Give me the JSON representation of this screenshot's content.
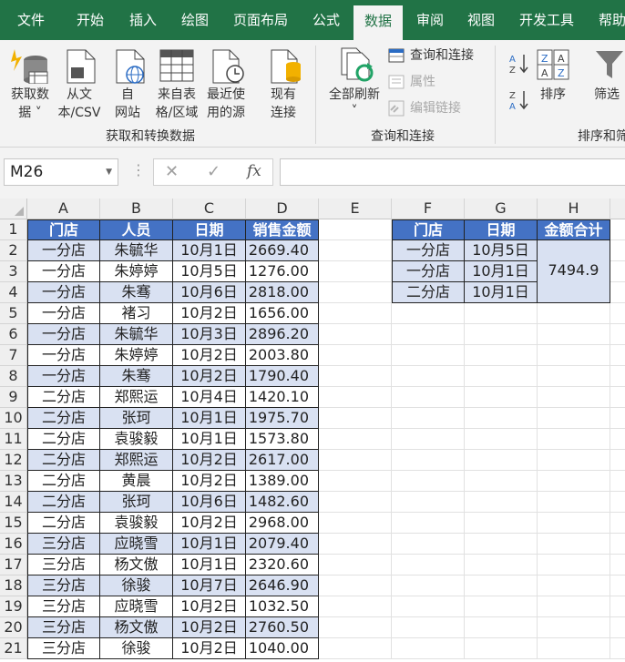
{
  "menu": {
    "tabs": [
      {
        "label": "文件"
      },
      {
        "label": "开始"
      },
      {
        "label": "插入"
      },
      {
        "label": "绘图"
      },
      {
        "label": "页面布局"
      },
      {
        "label": "公式"
      },
      {
        "label": "数据",
        "active": true
      },
      {
        "label": "审阅"
      },
      {
        "label": "视图"
      },
      {
        "label": "开发工具"
      },
      {
        "label": "帮助"
      }
    ]
  },
  "ribbon": {
    "get_data": {
      "line1": "获取数",
      "line2": "据 ˅"
    },
    "from_csv": {
      "line1": "从文",
      "line2": "本/CSV"
    },
    "from_web": {
      "line1": "自",
      "line2": "网站"
    },
    "from_table": {
      "line1": "来自表",
      "line2": "格/区域"
    },
    "recent_sources": {
      "line1": "最近使",
      "line2": "用的源"
    },
    "existing_connections": {
      "line1": "现有",
      "line2": "连接"
    },
    "group_get_transform": "获取和转换数据",
    "refresh_all": {
      "line1": "全部刷新",
      "line2": "˅"
    },
    "queries_connections": "查询和连接",
    "properties": "属性",
    "edit_links": "编辑链接",
    "group_queries": "查询和连接",
    "sort": "排序",
    "filter": "筛选",
    "group_sort_filter": "排序和筛"
  },
  "formula_bar": {
    "name_box": "M26",
    "cancel_glyph": "✕",
    "enter_glyph": "✓",
    "fx": "fx",
    "formula": ""
  },
  "sheet": {
    "columns": [
      "A",
      "B",
      "C",
      "D",
      "E",
      "F",
      "G",
      "H"
    ],
    "rows": [
      "1",
      "2",
      "3",
      "4",
      "5",
      "6",
      "7",
      "8",
      "9",
      "10",
      "11",
      "12",
      "13",
      "14",
      "15",
      "16",
      "17",
      "18",
      "19",
      "20",
      "21"
    ],
    "main_table": {
      "headers": [
        "门店",
        "人员",
        "日期",
        "销售金额"
      ],
      "rows": [
        [
          "一分店",
          "朱毓华",
          "10月1日",
          "2669.40"
        ],
        [
          "一分店",
          "朱婷婷",
          "10月5日",
          "1276.00"
        ],
        [
          "一分店",
          "朱骞",
          "10月6日",
          "2818.00"
        ],
        [
          "一分店",
          "褚习",
          "10月2日",
          "1656.00"
        ],
        [
          "一分店",
          "朱毓华",
          "10月3日",
          "2896.20"
        ],
        [
          "一分店",
          "朱婷婷",
          "10月2日",
          "2003.80"
        ],
        [
          "一分店",
          "朱骞",
          "10月2日",
          "1790.40"
        ],
        [
          "二分店",
          "郑熙运",
          "10月4日",
          "1420.10"
        ],
        [
          "二分店",
          "张珂",
          "10月1日",
          "1975.70"
        ],
        [
          "二分店",
          "袁骏毅",
          "10月1日",
          "1573.80"
        ],
        [
          "二分店",
          "郑熙运",
          "10月2日",
          "2617.00"
        ],
        [
          "二分店",
          "黄晨",
          "10月2日",
          "1389.00"
        ],
        [
          "二分店",
          "张珂",
          "10月6日",
          "1482.60"
        ],
        [
          "二分店",
          "袁骏毅",
          "10月2日",
          "2968.00"
        ],
        [
          "三分店",
          "应晓雪",
          "10月1日",
          "2079.40"
        ],
        [
          "三分店",
          "杨文傲",
          "10月1日",
          "2320.60"
        ],
        [
          "三分店",
          "徐骏",
          "10月7日",
          "2646.90"
        ],
        [
          "三分店",
          "应晓雪",
          "10月2日",
          "1032.50"
        ],
        [
          "三分店",
          "杨文傲",
          "10月2日",
          "2760.50"
        ],
        [
          "三分店",
          "徐骏",
          "10月2日",
          "1040.00"
        ]
      ]
    },
    "criteria_table": {
      "headers": [
        "门店",
        "日期",
        "金额合计"
      ],
      "rows": [
        [
          "一分店",
          "10月5日"
        ],
        [
          "一分店",
          "10月1日"
        ],
        [
          "二分店",
          "10月1日"
        ]
      ],
      "total": "7494.9"
    },
    "colors": {
      "header_fill": "#4472c4",
      "band_fill": "#d9e1f2",
      "accent": "#217346"
    }
  }
}
